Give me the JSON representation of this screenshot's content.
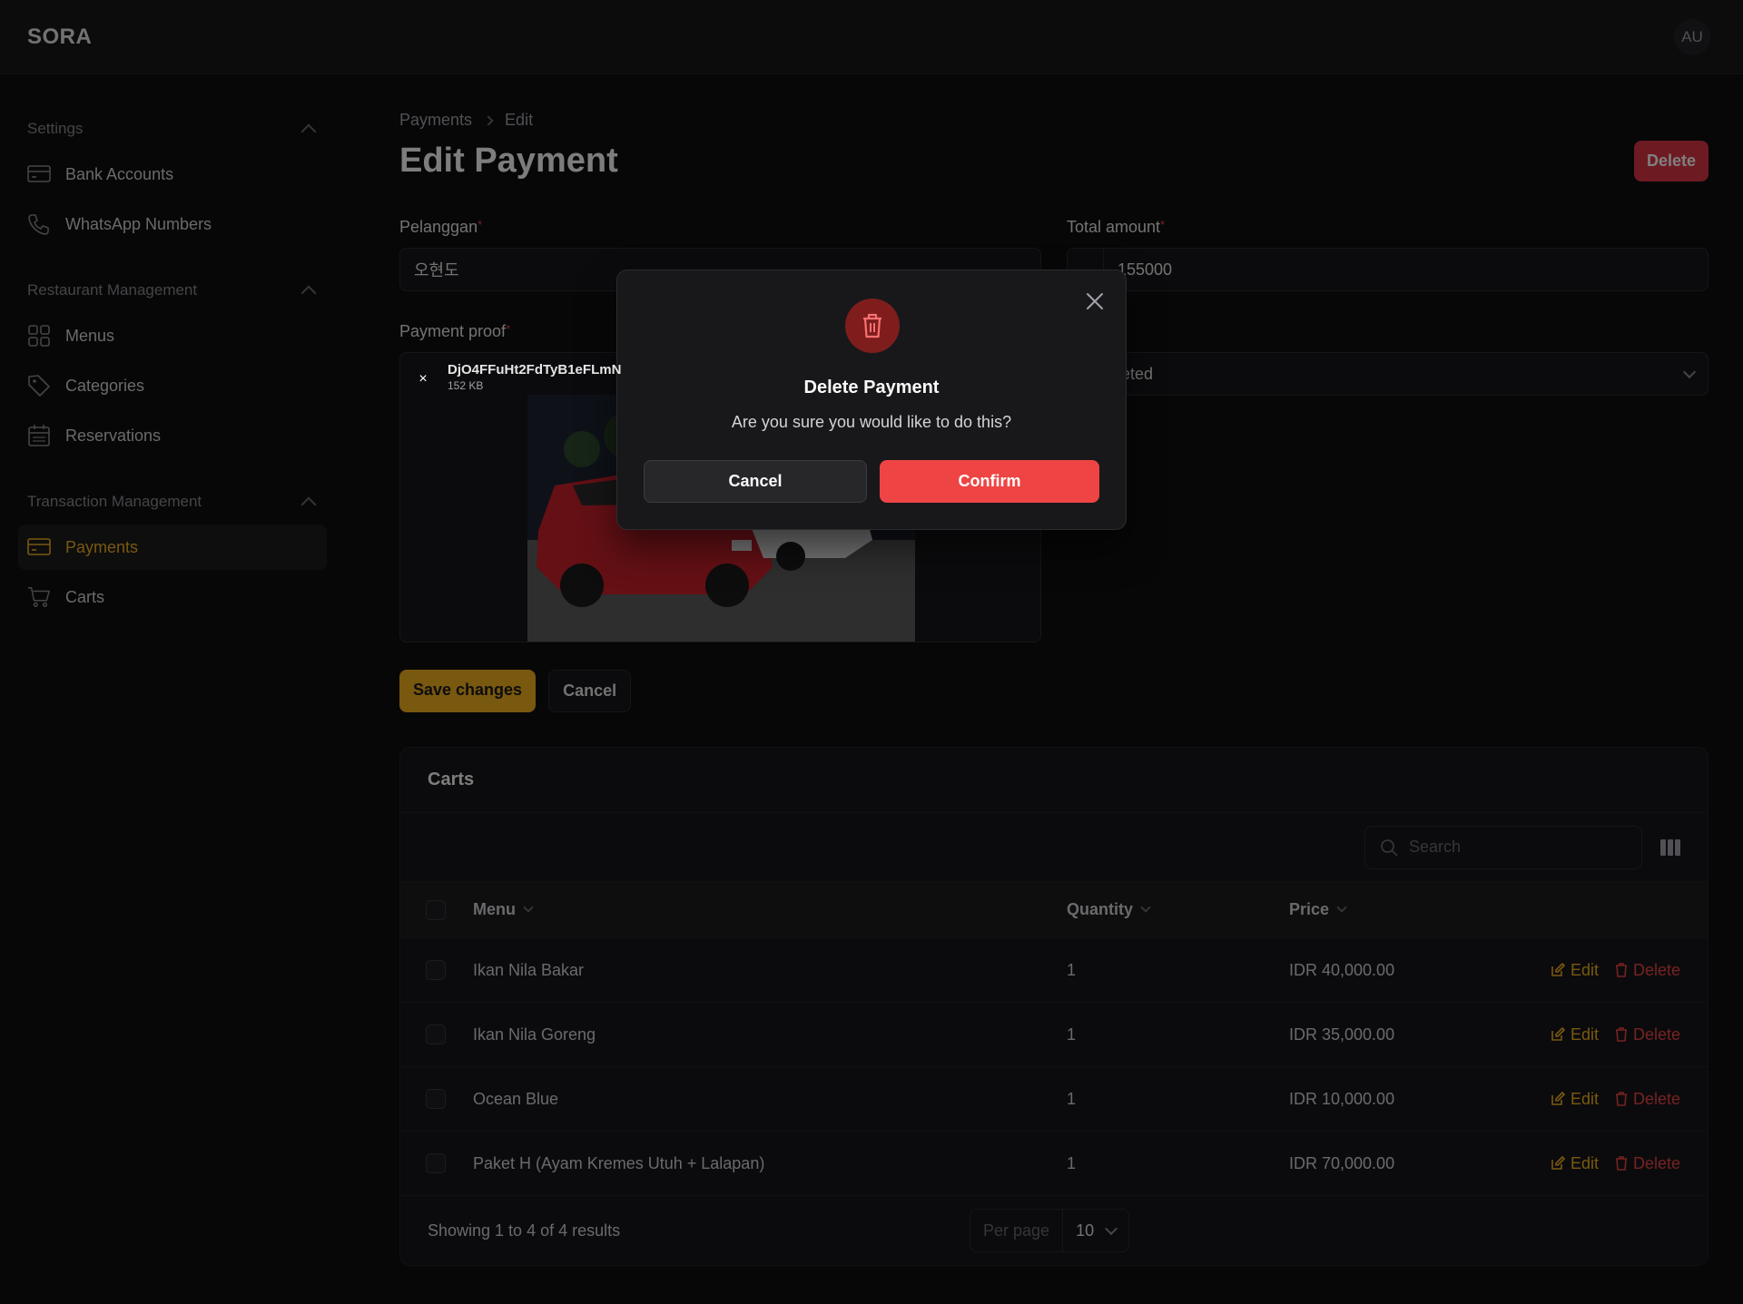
{
  "app": {
    "brand": "SORA",
    "avatar": "AU"
  },
  "sidebar": {
    "groups": [
      {
        "label": "Settings",
        "items": [
          {
            "label": "Bank Accounts",
            "icon": "credit-card-icon"
          },
          {
            "label": "WhatsApp Numbers",
            "icon": "phone-icon"
          }
        ]
      },
      {
        "label": "Restaurant Management",
        "items": [
          {
            "label": "Menus",
            "icon": "grid-icon"
          },
          {
            "label": "Categories",
            "icon": "tag-icon"
          },
          {
            "label": "Reservations",
            "icon": "calendar-icon"
          }
        ]
      },
      {
        "label": "Transaction Management",
        "items": [
          {
            "label": "Payments",
            "icon": "credit-card-icon",
            "active": true
          },
          {
            "label": "Carts",
            "icon": "shopping-cart-icon"
          }
        ]
      }
    ]
  },
  "breadcrumb": {
    "items": [
      "Payments",
      "Edit"
    ]
  },
  "page": {
    "title": "Edit Payment",
    "delete_label": "Delete"
  },
  "form": {
    "customer": {
      "label": "Pelanggan",
      "required": "*",
      "value": "오현도"
    },
    "total": {
      "label": "Total amount",
      "required": "*",
      "value": "155000"
    },
    "proof": {
      "label": "Payment proof",
      "required": "*",
      "file_name": "DjO4FFuHt2FdTyB1eFLmN",
      "file_size": "152 KB",
      "remove": "×"
    },
    "status": {
      "value": "leted"
    },
    "save_label": "Save changes",
    "cancel_label": "Cancel"
  },
  "carts": {
    "title": "Carts",
    "search_placeholder": "Search",
    "columns": [
      "Menu",
      "Quantity",
      "Price"
    ],
    "rows": [
      {
        "menu": "Ikan Nila Bakar",
        "qty": "1",
        "price": "IDR 40,000.00"
      },
      {
        "menu": "Ikan Nila Goreng",
        "qty": "1",
        "price": "IDR 35,000.00"
      },
      {
        "menu": "Ocean Blue",
        "qty": "1",
        "price": "IDR 10,000.00"
      },
      {
        "menu": "Paket H (Ayam Kremes Utuh + Lalapan)",
        "qty": "1",
        "price": "IDR 70,000.00"
      }
    ],
    "edit_label": "Edit",
    "delete_label": "Delete",
    "summary": "Showing 1 to 4 of 4 results",
    "per_page_label": "Per page",
    "per_page_value": "10"
  },
  "modal": {
    "title": "Delete Payment",
    "description": "Are you sure you would like to do this?",
    "cancel_label": "Cancel",
    "confirm_label": "Confirm"
  },
  "colors": {
    "accent": "#f2b01e",
    "danger": "#ef4444",
    "background": "#0f0f10"
  }
}
